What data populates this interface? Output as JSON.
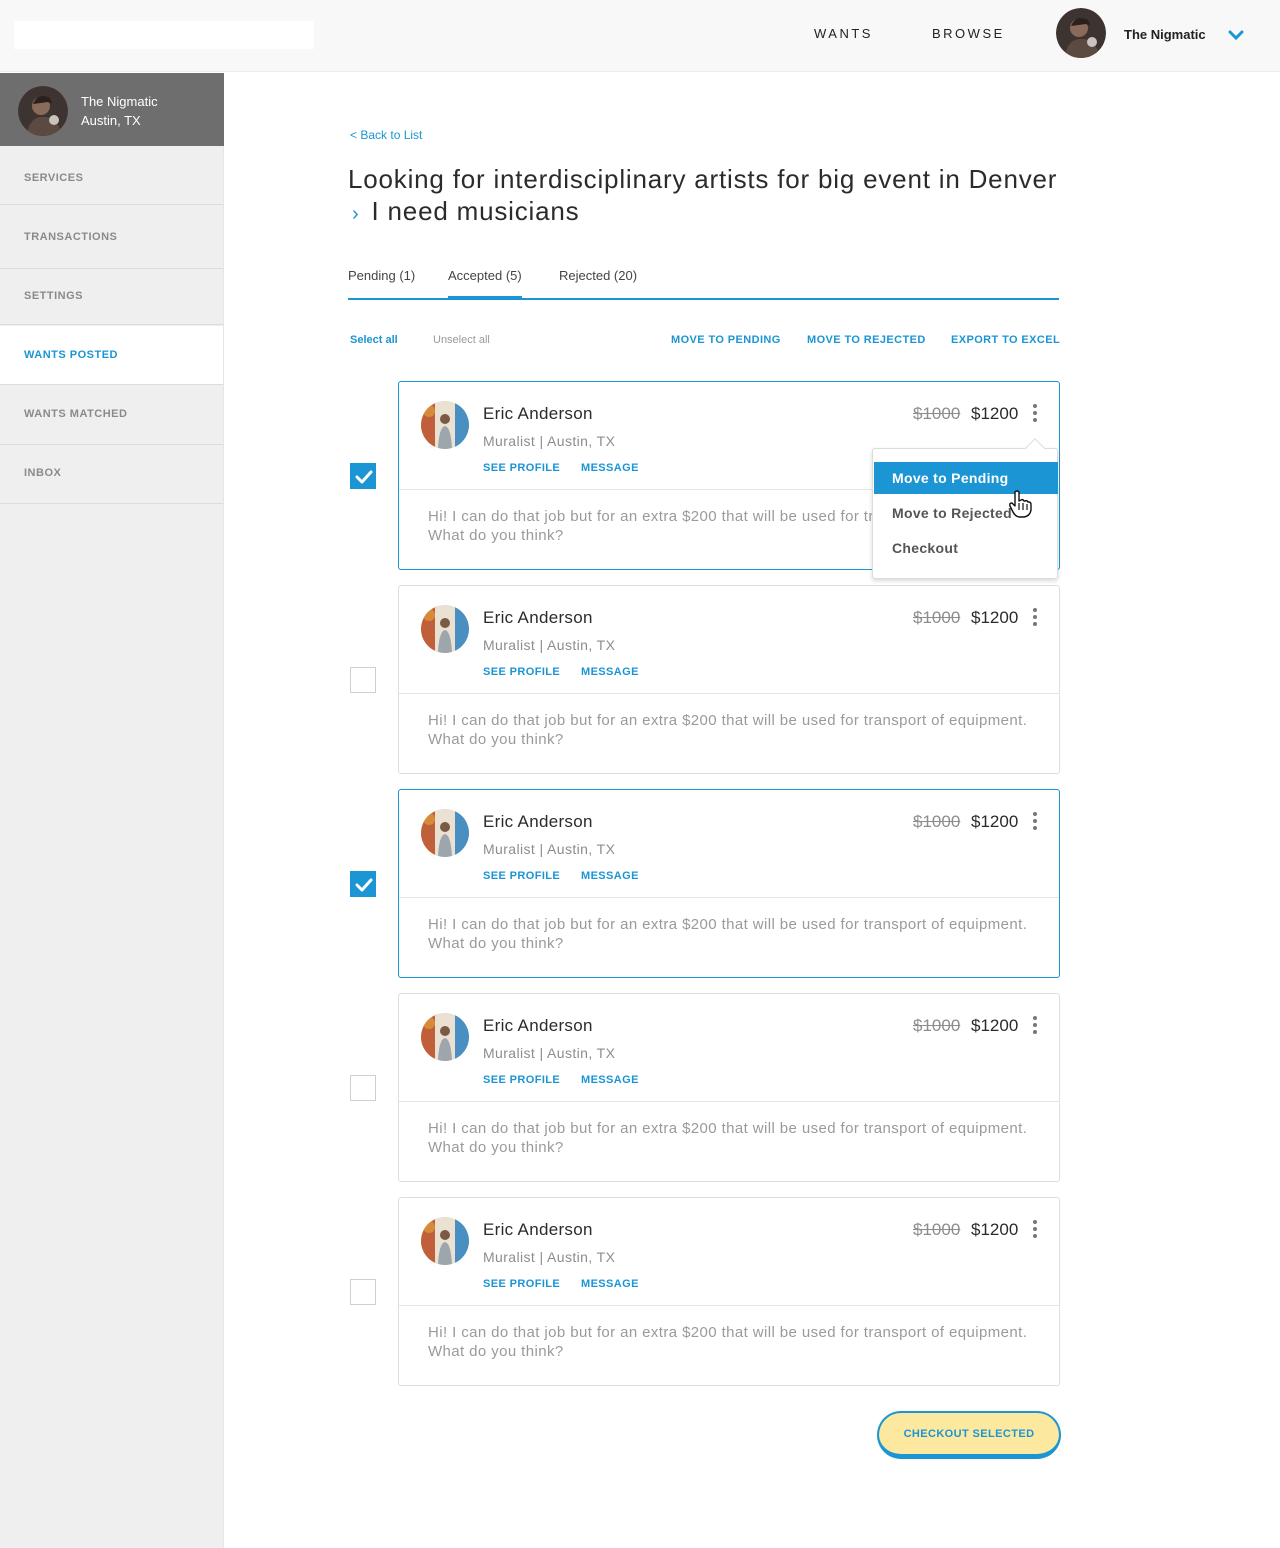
{
  "header": {
    "nav": [
      {
        "label": "WANTS"
      },
      {
        "label": "BROWSE"
      }
    ],
    "username": "The Nigmatic",
    "user_menu_icon": "chevron-down-icon",
    "accent": "#1b95d3"
  },
  "sidebar": {
    "profile": {
      "name": "The Nigmatic",
      "location": "Austin, TX"
    },
    "items": [
      {
        "label": "SERVICES"
      },
      {
        "label": "TRANSACTIONS"
      },
      {
        "label": "SETTINGS"
      },
      {
        "label": "WANTS POSTED"
      },
      {
        "label": "WANTS MATCHED"
      },
      {
        "label": "INBOX"
      }
    ],
    "active": "WANTS POSTED"
  },
  "main": {
    "back_link": "< Back to List",
    "title_part1": "Looking for interdisciplinary artists for big event in Denver",
    "title_sep": "›",
    "title_part2": "I need musicians",
    "tabs": [
      {
        "label": "Pending (1)"
      },
      {
        "label": "Accepted (5)"
      },
      {
        "label": "Rejected (20)"
      }
    ],
    "active_tab": "Accepted (5)",
    "actions": {
      "select_all": "Select all",
      "unselect_all": "Unselect all",
      "move_pending": "MOVE TO PENDING",
      "move_rejected": "MOVE TO REJECTED",
      "export": "EXPORT TO EXCEL"
    },
    "cards": [
      {
        "name": "Eric Anderson",
        "subtitle": "Muralist | Austin, TX",
        "old_price": "$1000",
        "price": "$1200",
        "see_profile": "SEE PROFILE",
        "message_link": "MESSAGE",
        "message": "Hi! I can do that job but for an extra $200 that will be used for transport of equipment. What do you think?",
        "checked": true
      },
      {
        "name": "Eric Anderson",
        "subtitle": "Muralist | Austin, TX",
        "old_price": "$1000",
        "price": "$1200",
        "see_profile": "SEE PROFILE",
        "message_link": "MESSAGE",
        "message": "Hi! I can do that job but for an extra $200 that will be used for transport of equipment. What do you think?",
        "checked": false
      },
      {
        "name": "Eric Anderson",
        "subtitle": "Muralist | Austin, TX",
        "old_price": "$1000",
        "price": "$1200",
        "see_profile": "SEE PROFILE",
        "message_link": "MESSAGE",
        "message": "Hi! I can do that job but for an extra $200 that will be used for transport of equipment. What do you think?",
        "checked": true
      },
      {
        "name": "Eric Anderson",
        "subtitle": "Muralist | Austin, TX",
        "old_price": "$1000",
        "price": "$1200",
        "see_profile": "SEE PROFILE",
        "message_link": "MESSAGE",
        "message": "Hi! I can do that job but for an extra $200 that will be used for transport of equipment. What do you think?",
        "checked": false
      },
      {
        "name": "Eric Anderson",
        "subtitle": "Muralist | Austin, TX",
        "old_price": "$1000",
        "price": "$1200",
        "see_profile": "SEE PROFILE",
        "message_link": "MESSAGE",
        "message": "Hi! I can do that job but for an extra $200 that will be used for transport of equipment. What do you think?",
        "checked": false
      }
    ],
    "dropdown": {
      "items": [
        {
          "label": "Move to Pending"
        },
        {
          "label": "Move to Rejected"
        },
        {
          "label": "Checkout"
        }
      ],
      "hovered": "Move to Pending"
    },
    "checkout_button": "CHECKOUT SELECTED"
  }
}
